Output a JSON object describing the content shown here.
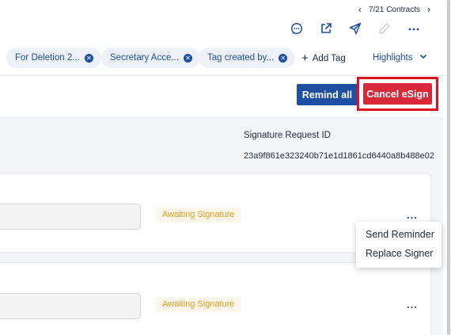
{
  "nav": {
    "counter": "7/21 Contracts",
    "prev_icon": "chevron-left-icon",
    "next_icon": "chevron-right-icon"
  },
  "toolbar": {
    "icons": [
      "comment-icon",
      "external-link-icon",
      "send-icon",
      "edit-icon",
      "more-horizontal-icon"
    ]
  },
  "tags": [
    {
      "label": "For Deletion 2..."
    },
    {
      "label": "Secretary Acce..."
    },
    {
      "label": "Tag created by..."
    }
  ],
  "add_tag_label": "Add Tag",
  "highlights_label": "Highlights",
  "buttons": {
    "remind_all": "Remind all",
    "cancel_esign": "Cancel eSign"
  },
  "signature_request": {
    "label": "Signature Request ID",
    "id": "23a9f861e323240b71e1d1861cd6440a8b488e02"
  },
  "signers": [
    {
      "status": "Awaiting Signature",
      "more": "..."
    },
    {
      "status": "Awaiting Signature",
      "more": "..."
    }
  ],
  "context_menu": {
    "items": [
      "Send Reminder",
      "Replace Signer"
    ]
  },
  "colors": {
    "accent": "#1e4fa3",
    "danger": "#d9283a",
    "highlight_border": "#e01020",
    "status": "#e89a1e"
  }
}
